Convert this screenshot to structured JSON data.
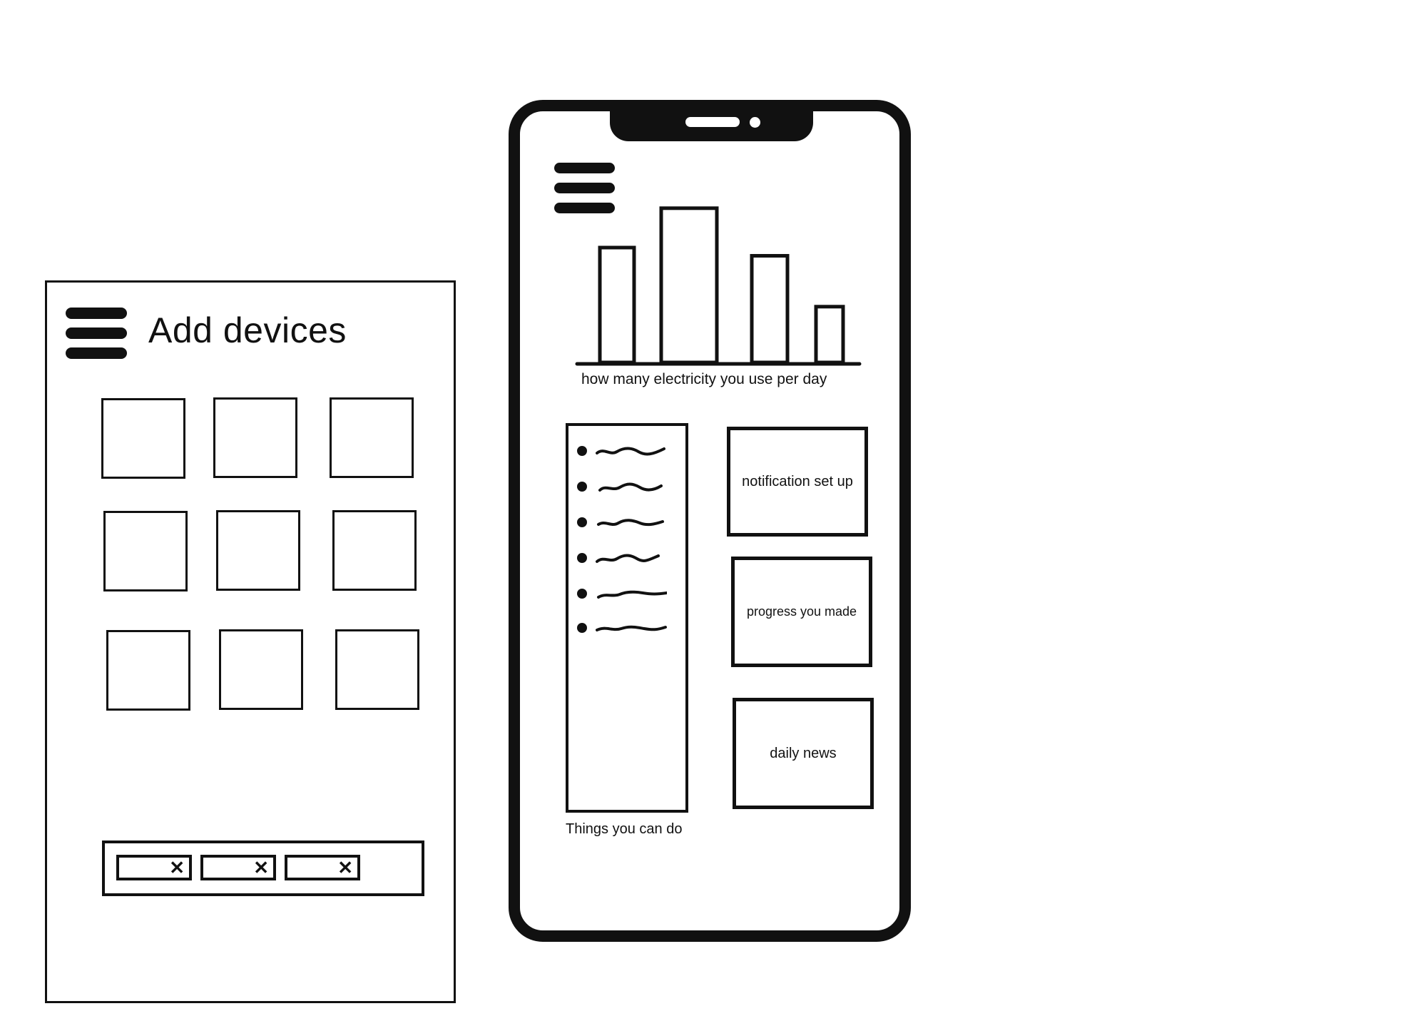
{
  "add_devices_screen": {
    "title": "Add devices",
    "device_tile_count": 9,
    "tray_chip_close_glyph": "✕",
    "tray_chip_count": 3
  },
  "main_screen": {
    "chart_data": {
      "type": "bar",
      "categories": [
        "",
        "",
        "",
        ""
      ],
      "values": [
        70,
        94,
        65,
        34
      ],
      "ylim": [
        0,
        100
      ],
      "xlabel": "how many electricity you use per day"
    },
    "todo": {
      "caption": "Things you can do",
      "item_count": 6
    },
    "cards": {
      "notification": "notification set up",
      "progress": "progress you made",
      "news": "daily news"
    }
  },
  "icons": {
    "menu": "hamburger-menu-icon",
    "close": "close-icon"
  },
  "colors": {
    "ink": "#111111",
    "paper": "#ffffff"
  }
}
